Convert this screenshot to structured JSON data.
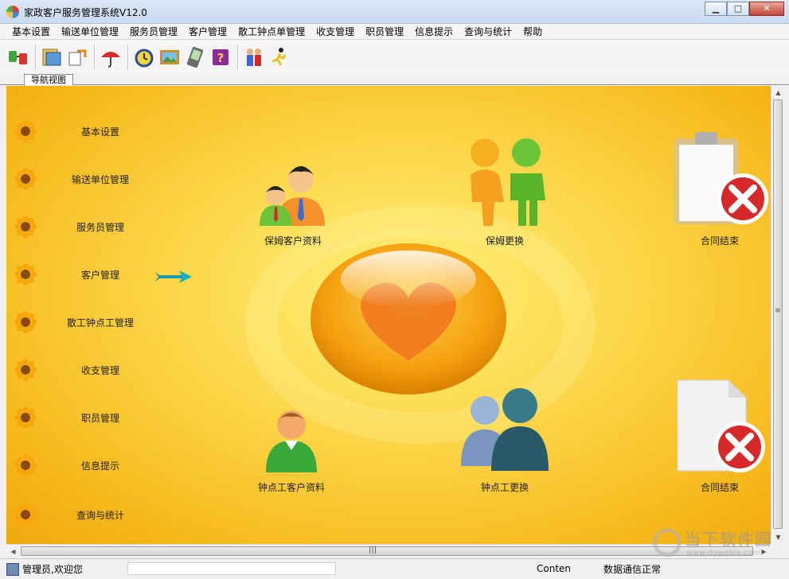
{
  "window": {
    "title": "家政客户服务管理系统V12.0",
    "min": "▁",
    "max": "□",
    "close": "✕"
  },
  "menu": [
    "基本设置",
    "输送单位管理",
    "服务员管理",
    "客户管理",
    "散工钟点单管理",
    "收支管理",
    "职员管理",
    "信息提示",
    "查询与统计",
    "帮助"
  ],
  "toolbar_icons": [
    "connect-icon",
    "folder-icon",
    "transfer-icon",
    "umbrella-icon",
    "alarm-clock-icon",
    "picture-icon",
    "pda-icon",
    "help-book-icon",
    "people-icon",
    "runner-icon"
  ],
  "nav_tab": "导航视图",
  "nav_items": [
    "基本设置",
    "输送单位管理",
    "服务员管理",
    "客户管理",
    "散工钟点工管理",
    "收支管理",
    "职员管理",
    "信息提示",
    "查询与统计"
  ],
  "features": {
    "nanny_customer": "保姆客户资料",
    "nanny_change": "保姆更换",
    "contract_end_1": "合同结束",
    "hourly_customer": "钟点工客户资料",
    "hourly_change": "钟点工更换",
    "contract_end_2": "合同结束"
  },
  "status": {
    "user": "管理员,欢迎您",
    "conten": "Conten",
    "comm": "数据通信正常"
  },
  "watermark": {
    "text": "当下软件园",
    "url": "www.downxia.com"
  },
  "colors": {
    "bg_yellow": "#fcd74a",
    "accent_red": "#d62a2a",
    "accent_green": "#6cc43a"
  }
}
